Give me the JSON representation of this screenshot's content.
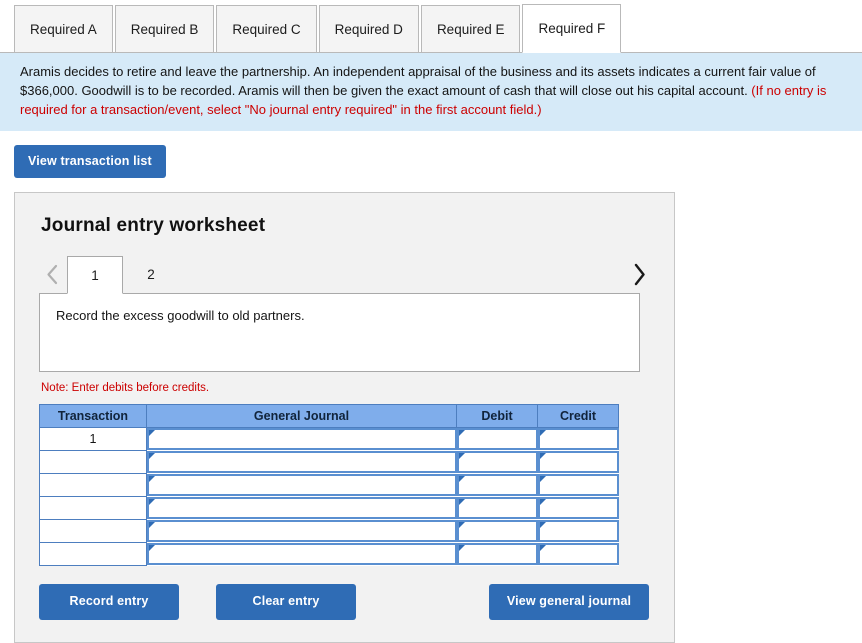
{
  "tabs": [
    {
      "label": "Required A",
      "active": false
    },
    {
      "label": "Required B",
      "active": false
    },
    {
      "label": "Required C",
      "active": false
    },
    {
      "label": "Required D",
      "active": false
    },
    {
      "label": "Required E",
      "active": false
    },
    {
      "label": "Required F",
      "active": true
    }
  ],
  "instructions": {
    "body": "Aramis decides to retire and leave the partnership. An independent appraisal of the business and its assets indicates a current fair value of $366,000. Goodwill is to be recorded. Aramis will then be given the exact amount of cash that will close out his capital account. ",
    "red_note": "(If no entry is required for a transaction/event, select \"No journal entry required\" in the first account field.)"
  },
  "toolbar": {
    "view_transaction_list_label": "View transaction list"
  },
  "worksheet": {
    "title": "Journal entry worksheet",
    "pager": {
      "prev_icon": "chevron-left-icon",
      "next_icon": "chevron-right-icon",
      "pages": [
        {
          "label": "1",
          "active": true
        },
        {
          "label": "2",
          "active": false
        }
      ]
    },
    "description": "Record the excess goodwill to old partners.",
    "note": "Note: Enter debits before credits.",
    "table": {
      "headers": [
        "Transaction",
        "General Journal",
        "Debit",
        "Credit"
      ],
      "rows": [
        {
          "transaction": "1",
          "general_journal": "",
          "debit": "",
          "credit": ""
        },
        {
          "transaction": "",
          "general_journal": "",
          "debit": "",
          "credit": ""
        },
        {
          "transaction": "",
          "general_journal": "",
          "debit": "",
          "credit": ""
        },
        {
          "transaction": "",
          "general_journal": "",
          "debit": "",
          "credit": ""
        },
        {
          "transaction": "",
          "general_journal": "",
          "debit": "",
          "credit": ""
        },
        {
          "transaction": "",
          "general_journal": "",
          "debit": "",
          "credit": ""
        }
      ]
    },
    "buttons": {
      "record_entry": "Record entry",
      "clear_entry": "Clear entry",
      "view_general_journal": "View general journal"
    }
  },
  "colors": {
    "accent_blue": "#2f6cb5",
    "table_header_blue": "#7fadeb",
    "table_border_blue": "#4d7ebf",
    "instruction_bg": "#d6eaf8",
    "panel_bg": "#f2f2f2",
    "red_note": "#cc0000"
  }
}
